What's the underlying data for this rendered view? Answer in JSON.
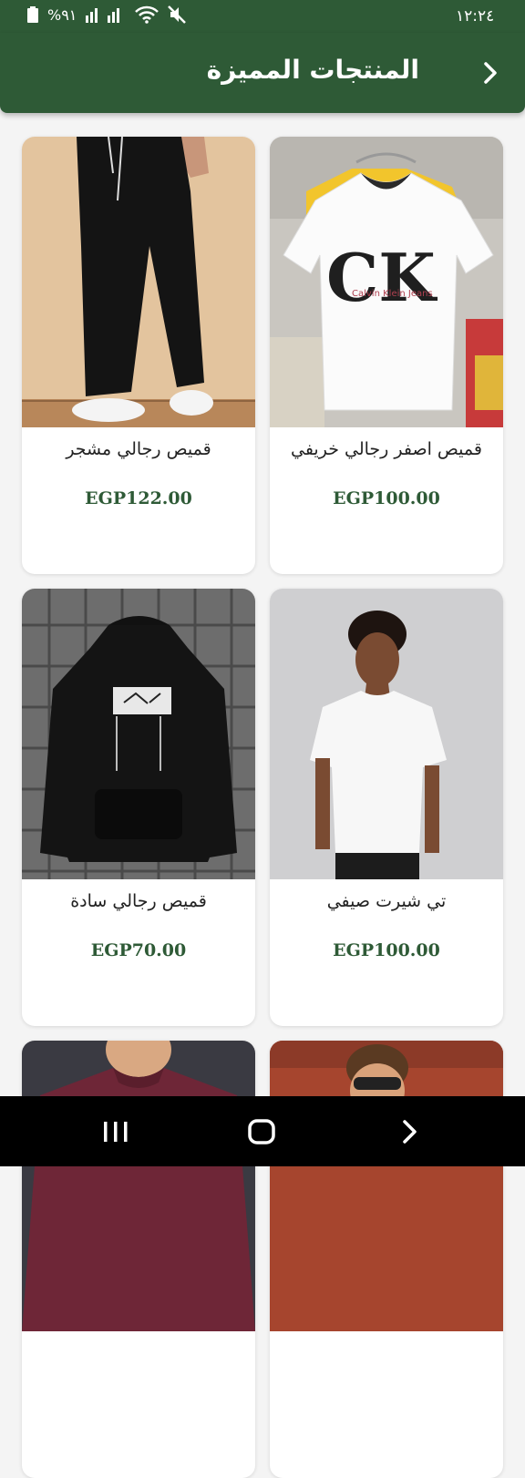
{
  "status": {
    "time": "١٢:٢٤",
    "battery": "%٩١"
  },
  "header": {
    "title": "المنتجات المميزة",
    "back_icon": "chevron-right-icon"
  },
  "products": [
    {
      "name": "قميص اصفر رجالي خريفي",
      "price": "EGP100.00"
    },
    {
      "name": "قميص رجالي مشجر",
      "price": "EGP122.00"
    },
    {
      "name": "تي شيرت صيفي",
      "price": "EGP100.00"
    },
    {
      "name": "قميص رجالي سادة",
      "price": "EGP70.00"
    },
    {
      "name": "",
      "price": ""
    },
    {
      "name": "",
      "price": ""
    }
  ],
  "colors": {
    "primary": "#2e5a36",
    "background": "#f4f4f4",
    "card": "#ffffff"
  }
}
